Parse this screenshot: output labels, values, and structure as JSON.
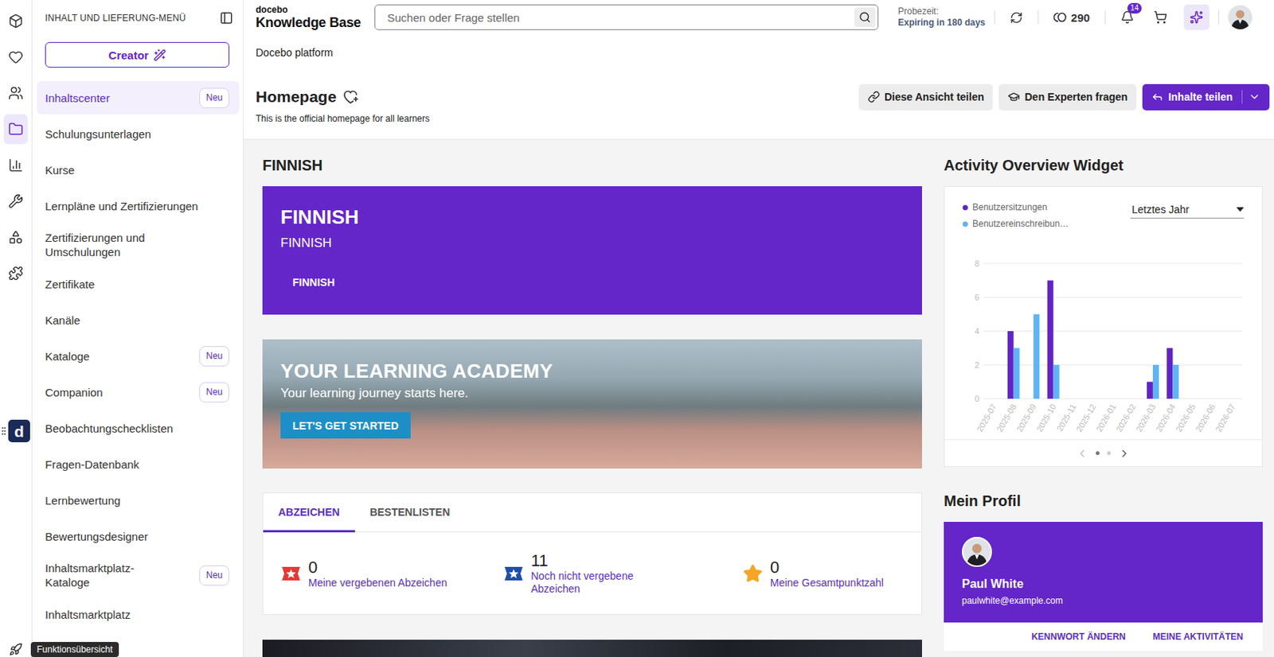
{
  "topbar": {
    "logo_small": "docebo",
    "logo_title": "Knowledge Base",
    "search_placeholder": "Suchen oder Frage stellen",
    "trial_label": "Probezeit:",
    "trial_value": "Expiring in 180 days",
    "coins": "290",
    "notifications": "14"
  },
  "rail": {
    "items": [
      {
        "selected": false
      },
      {
        "selected": false
      },
      {
        "selected": false
      },
      {
        "selected": true
      },
      {
        "selected": false
      },
      {
        "selected": false
      },
      {
        "selected": false
      },
      {
        "selected": false
      }
    ],
    "tooltip": "Funktionsübersicht"
  },
  "floating_widget": {
    "label": "d"
  },
  "sidebar": {
    "title": "INHALT UND LIEFERUNG-MENÜ",
    "creator_button": "Creator",
    "items": [
      {
        "label": "Inhaltscenter",
        "badge": "Neu",
        "selected": true
      },
      {
        "label": "Schulungsunterlagen",
        "badge": "",
        "selected": false
      },
      {
        "label": "Kurse",
        "badge": "",
        "selected": false
      },
      {
        "label": "Lernpläne und Zertifizierungen",
        "badge": "",
        "selected": false
      },
      {
        "label": "Zertifizierungen und Umschulungen",
        "badge": "",
        "selected": false
      },
      {
        "label": "Zertifikate",
        "badge": "",
        "selected": false
      },
      {
        "label": "Kanäle",
        "badge": "",
        "selected": false
      },
      {
        "label": "Kataloge",
        "badge": "Neu",
        "selected": false
      },
      {
        "label": "Companion",
        "badge": "Neu",
        "selected": false
      },
      {
        "label": "Beobachtungschecklisten",
        "badge": "",
        "selected": false
      },
      {
        "label": "Fragen-Datenbank",
        "badge": "",
        "selected": false
      },
      {
        "label": "Lernbewertung",
        "badge": "",
        "selected": false
      },
      {
        "label": "Bewertungsdesigner",
        "badge": "",
        "selected": false
      },
      {
        "label": "Inhaltsmarktplatz-Kataloge",
        "badge": "Neu",
        "selected": false
      },
      {
        "label": "Inhaltsmarktplatz",
        "badge": "",
        "selected": false
      }
    ]
  },
  "breadcrumb": "Docebo platform",
  "page": {
    "title": "Homepage",
    "subtitle": "This is the official homepage for all learners",
    "buttons": [
      {
        "label": "Diese Ansicht teilen",
        "kind": "secondary"
      },
      {
        "label": "Den Experten fragen",
        "kind": "secondary"
      },
      {
        "label": "Inhalte teilen",
        "kind": "primary"
      }
    ]
  },
  "finnish_widget": {
    "section_title": "FINNISH",
    "title": "FINNISH",
    "subtitle": "FINNISH",
    "link": "FINNISH"
  },
  "hero_banner": {
    "title": "YOUR LEARNING ACADEMY",
    "subtitle": "Your learning journey starts here.",
    "button": "LET'S GET STARTED"
  },
  "gamification": {
    "tabs": [
      {
        "label": "ABZEICHEN",
        "selected": true
      },
      {
        "label": "BESTENLISTEN",
        "selected": false
      }
    ],
    "stats": [
      {
        "value": "0",
        "label": "Meine vergebenen Abzeichen",
        "color": "#e53935",
        "kind": "ribbon"
      },
      {
        "value": "11",
        "label": "Noch nicht vergebene Abzeichen",
        "color": "#1e4fa8",
        "kind": "ribbon"
      },
      {
        "value": "0",
        "label": "Meine Gesamtpunktzahl",
        "color": "#f5a623",
        "kind": "star"
      }
    ]
  },
  "activity_widget": {
    "title": "Activity Overview Widget",
    "period": "Letztes Jahr",
    "y_ticks": [
      "0",
      "2",
      "4",
      "6",
      "8"
    ],
    "y_max": 8,
    "x_labels": [
      "2025-07",
      "2025-08",
      "2025-09",
      "2025-10",
      "2025-11",
      "2025-12",
      "2026-01",
      "2026-02",
      "2026-03",
      "2026-04",
      "2026-05",
      "2026-06",
      "2026-07"
    ],
    "series": [
      {
        "name": "Benutzersitzungen",
        "color": "#6123c6",
        "values": [
          0,
          4,
          0,
          7,
          0,
          0,
          0,
          0,
          1,
          3,
          0,
          0,
          0
        ]
      },
      {
        "name": "Benutzereinschreibun…",
        "color": "#5fb4f5",
        "values": [
          0,
          3,
          5,
          2,
          0,
          0,
          0,
          0,
          2,
          2,
          0,
          0,
          0
        ]
      }
    ],
    "pages": [
      {
        "selected": true
      },
      {
        "selected": false
      }
    ]
  },
  "profile": {
    "section_title": "Mein Profil",
    "name": "Paul White",
    "email": "paulwhite@example.com",
    "links": [
      "KENNWORT ÄNDERN",
      "MEINE AKTIVITÄTEN"
    ]
  }
}
